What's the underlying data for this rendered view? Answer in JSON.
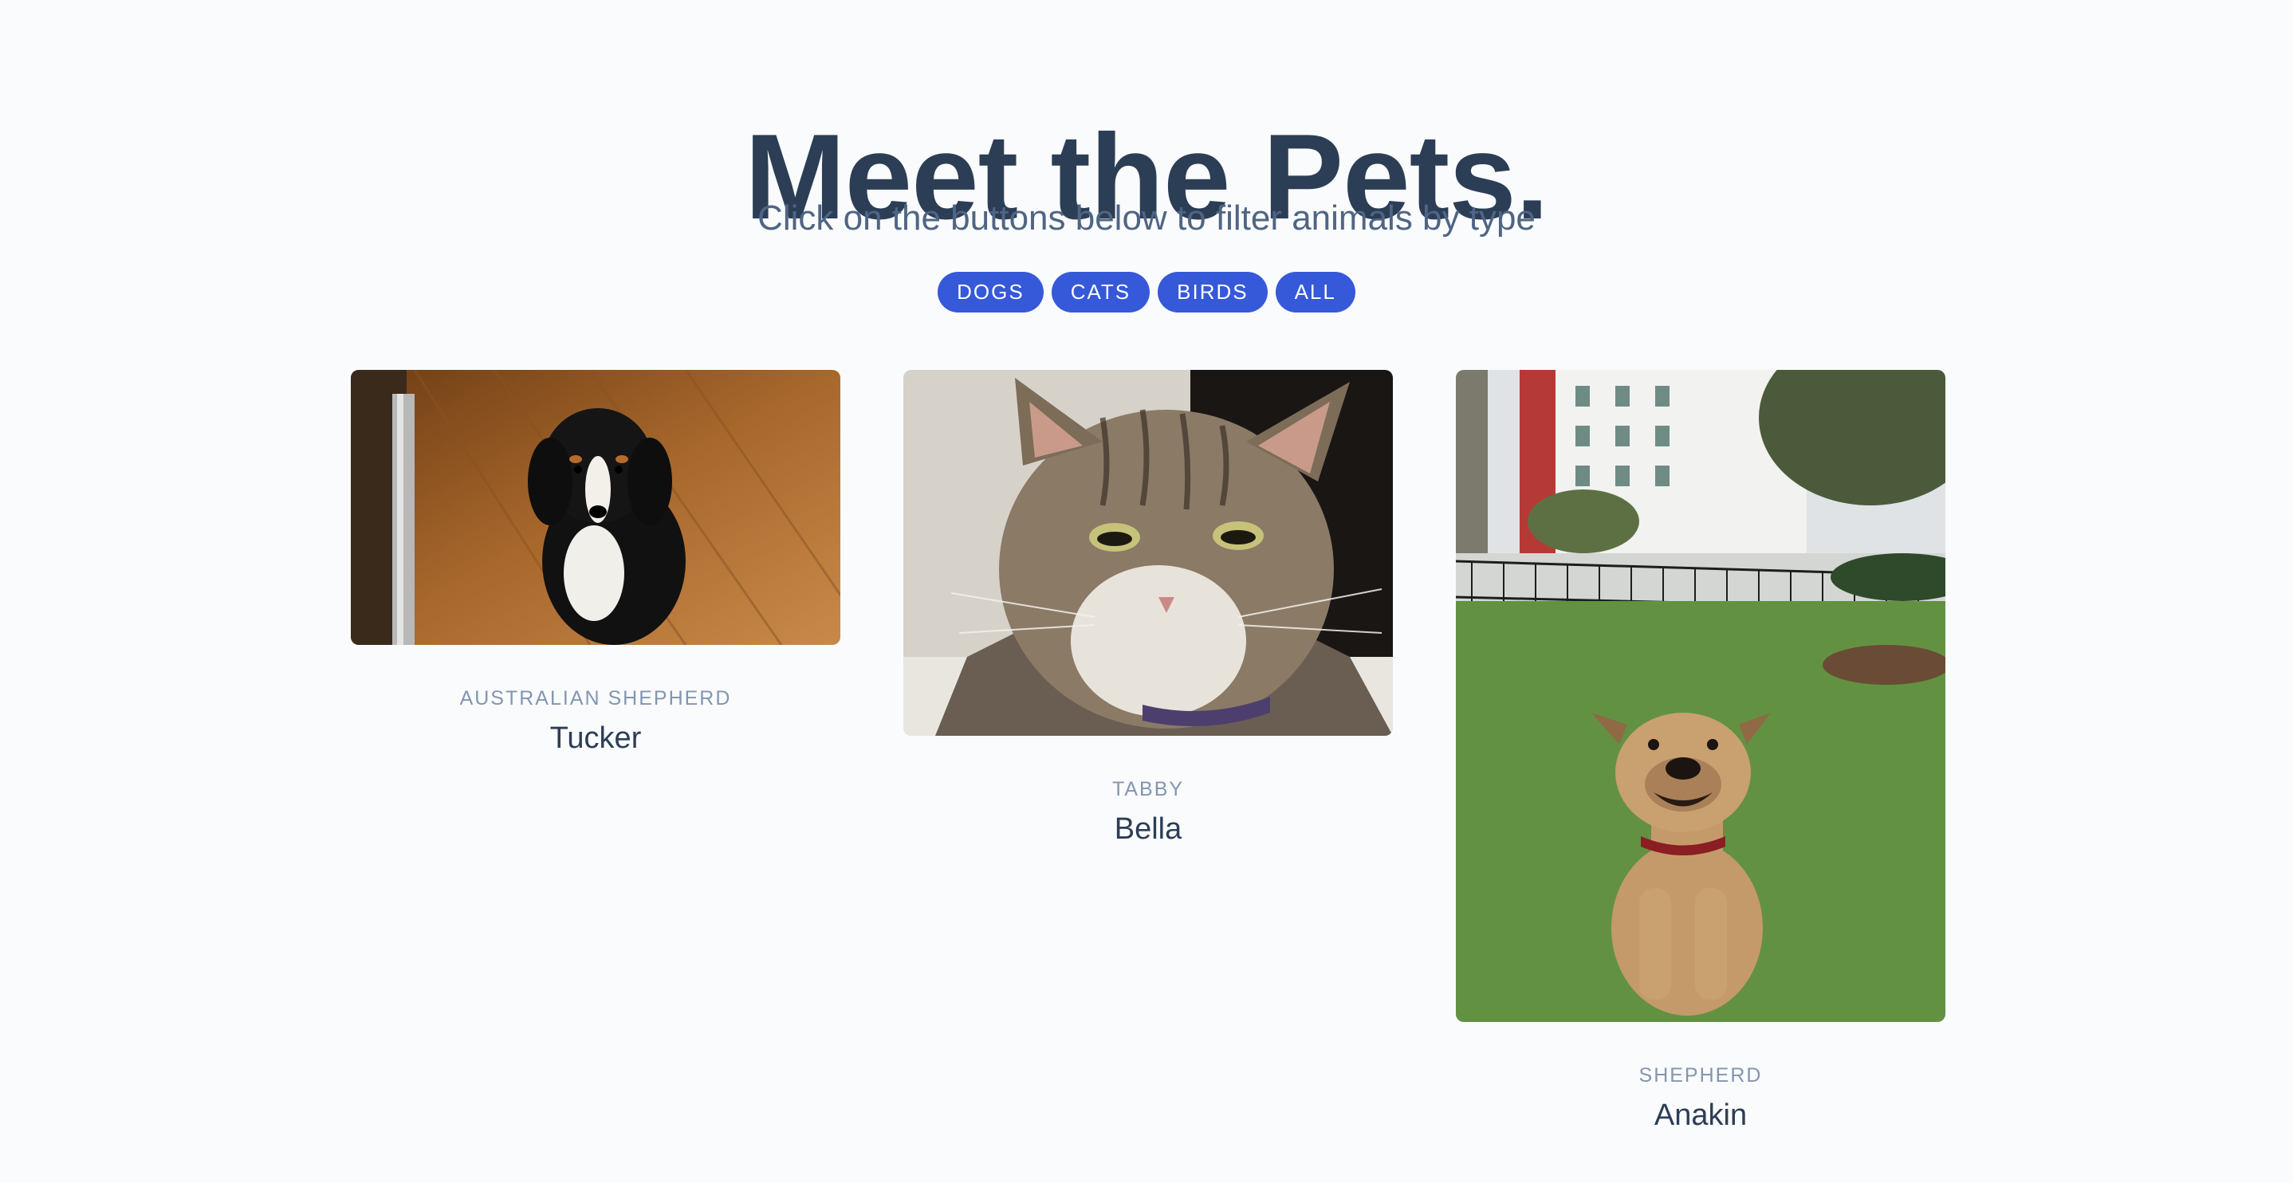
{
  "header": {
    "title": "Meet the Pets.",
    "subtitle": "Click on the buttons below to filter animals by type"
  },
  "filters": [
    {
      "label": "DOGS"
    },
    {
      "label": "CATS"
    },
    {
      "label": "BIRDS"
    },
    {
      "label": "ALL"
    }
  ],
  "pets": [
    {
      "breed": "AUSTRALIAN SHEPHERD",
      "name": "Tucker"
    },
    {
      "breed": "TABBY",
      "name": "Bella"
    },
    {
      "breed": "SHEPHERD",
      "name": "Anakin"
    }
  ],
  "colors": {
    "background": "#fafbfc",
    "title": "#2c3e56",
    "accent": "#3659d9",
    "breed_text": "#8396b0"
  }
}
